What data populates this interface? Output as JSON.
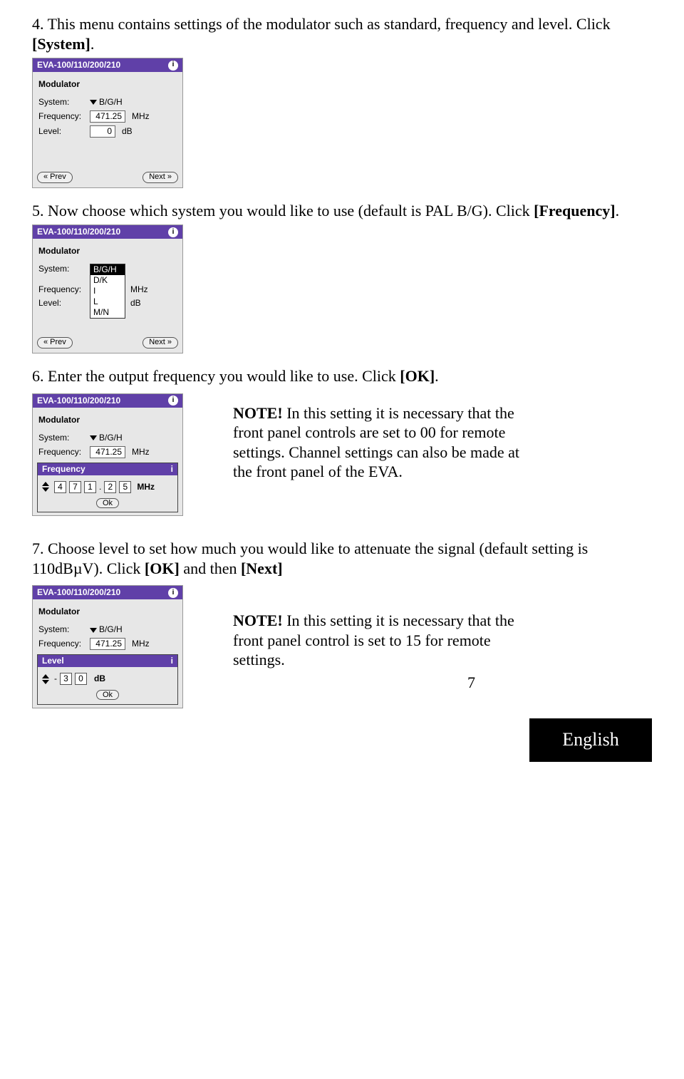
{
  "step4": {
    "text_a": "4. This menu contains settings of the modulator such as standard, frequency and level. Click ",
    "text_b": "[System]",
    "text_c": "."
  },
  "panel1": {
    "title": "EVA-100/110/200/210",
    "section": "Modulator",
    "system_label": "System:",
    "system_value": "B/G/H",
    "freq_label": "Frequency:",
    "freq_value": "471.25",
    "freq_unit": "MHz",
    "level_label": "Level:",
    "level_value": "0",
    "level_unit": "dB",
    "prev": "« Prev",
    "next": "Next »"
  },
  "step5": {
    "text_a": "5. Now choose which system you would like to use (default is PAL B/G). Click ",
    "text_b": "[Frequency]",
    "text_c": "."
  },
  "panel2": {
    "title": "EVA-100/110/200/210",
    "section": "Modulator",
    "system_label": "System:",
    "options": [
      "B/G/H",
      "D/K",
      "I",
      "L",
      "M/N"
    ],
    "freq_label": "Frequency:",
    "freq_unit": "MHz",
    "level_label": "Level:",
    "level_unit": "dB",
    "prev": "« Prev",
    "next": "Next »"
  },
  "step6": {
    "text_a": "6. Enter the output frequency you would like to use. Click ",
    "text_b": "[OK]",
    "text_c": "."
  },
  "panel3": {
    "title": "EVA-100/110/200/210",
    "section": "Modulator",
    "system_label": "System:",
    "system_value": "B/G/H",
    "freq_label": "Frequency:",
    "freq_value": "471.25",
    "freq_unit": "MHz",
    "sub_title": "Frequency",
    "digits": [
      "4",
      "7",
      "1"
    ],
    "dot": ".",
    "decimals": [
      "2",
      "5"
    ],
    "sub_unit": "MHz",
    "ok": "Ok"
  },
  "note1": {
    "head": "NOTE!",
    "body": " In this setting it is necessary that the front panel controls are set to 00 for remote settings. Channel settings can also be made at the front panel of the EVA."
  },
  "step7": {
    "text_a": "7. Choose level to set how much you would like to attenuate the signal (default setting is 110dBµV). Click ",
    "text_b": "[OK]",
    "text_c": " and then ",
    "text_d": "[Next]"
  },
  "panel4": {
    "title": "EVA-100/110/200/210",
    "section": "Modulator",
    "system_label": "System:",
    "system_value": "B/G/H",
    "freq_label": "Frequency:",
    "freq_value": "471.25",
    "freq_unit": "MHz",
    "sub_title": "Level",
    "minus": "-",
    "digits": [
      "3",
      "0"
    ],
    "sub_unit": "dB",
    "ok": "Ok"
  },
  "note2": {
    "head": "NOTE!",
    "body": " In this setting it is necessary that the front panel control is set to 15 for remote settings."
  },
  "page_number": "7",
  "language": "English"
}
